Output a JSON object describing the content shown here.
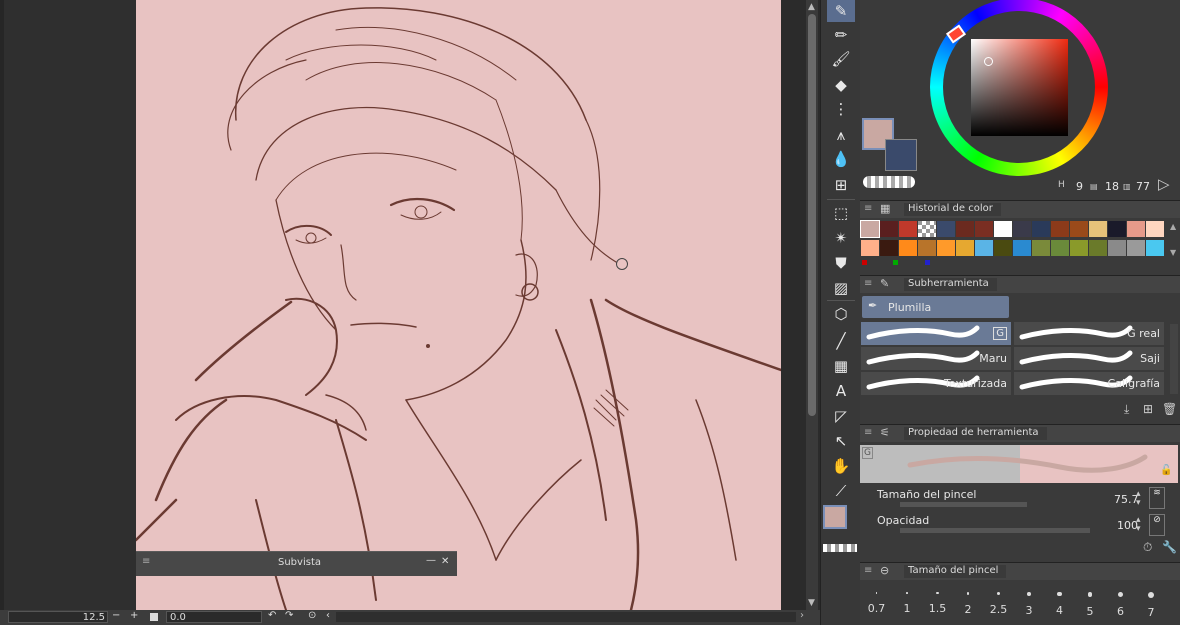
{
  "subview": {
    "title": "Subvista",
    "minimize": "—",
    "close": "✕"
  },
  "statusbar": {
    "zoom": "12.5",
    "minus": "−",
    "plus": "+",
    "rotation": "0.0"
  },
  "color_wheel": {
    "h_label": "H",
    "h_value": "9",
    "s_value": "18",
    "v_value": "77",
    "main_color": "#c9a8a2",
    "sub_color": "#3a4a6b"
  },
  "color_history": {
    "title": "Historial de color",
    "row1": [
      "#c9a8a2",
      "#5a1f1f",
      "#c0392b",
      "checker",
      "#3a4a6b",
      "#6b2a1f",
      "#7a2e22",
      "#ffffff",
      "#3a3a4a",
      "#2a3a5a",
      "#8b3a1a",
      "#9a4a1a",
      "#e6c27a",
      "#1a1a2a",
      "#e69a8a",
      "#ffd6c0"
    ],
    "row2": [
      "#ffb08a",
      "#3a1a10",
      "#ff8a1a",
      "#b8742a",
      "#ff9a2a",
      "#e6a830",
      "#5ab4e6",
      "#4a4a10",
      "#2a8ad0",
      "#7a8a3a",
      "#6a8a3a",
      "#8a9a2a",
      "#6a7a2a",
      "#8a8a8a",
      "#9a9a9a",
      "#4ac8f0"
    ]
  },
  "subtool": {
    "title": "Subherramienta",
    "group": "Plumilla",
    "brushes": [
      {
        "name": "G",
        "selected": true
      },
      {
        "name": "G real",
        "selected": false
      },
      {
        "name": "Maru",
        "selected": false
      },
      {
        "name": "Saji",
        "selected": false
      },
      {
        "name": "Texturizada",
        "selected": false
      },
      {
        "name": "Caligrafía",
        "selected": false
      }
    ]
  },
  "tool_property": {
    "title": "Propiedad de herramienta",
    "preview_tag": "G",
    "brush_size_label": "Tamaño del pincel",
    "brush_size_value": "75.7",
    "opacity_label": "Opacidad",
    "opacity_value": "100"
  },
  "brush_size_panel": {
    "title": "Tamaño del pincel",
    "sizes": [
      "0.7",
      "1",
      "1.5",
      "2",
      "2.5",
      "3",
      "4",
      "5",
      "6",
      "7"
    ]
  }
}
